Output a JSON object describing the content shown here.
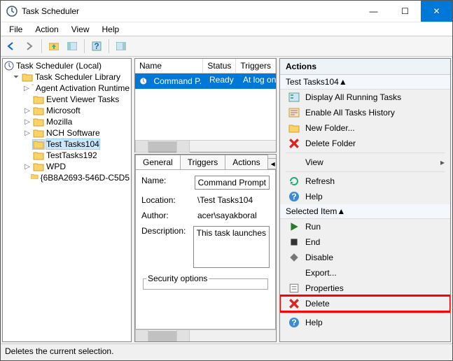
{
  "window": {
    "title": "Task Scheduler",
    "min": "—",
    "max": "☐",
    "close": "✕"
  },
  "menu": [
    "File",
    "Action",
    "View",
    "Help"
  ],
  "tree": {
    "root": "Task Scheduler (Local)",
    "lib": "Task Scheduler Library",
    "nodes": [
      "Agent Activation Runtime",
      "Event Viewer Tasks",
      "Microsoft",
      "Mozilla",
      "NCH Software",
      "Test Tasks104",
      "TestTasks192",
      "WPD",
      "{6B8A2693-546D-C5D5"
    ]
  },
  "tasklist": {
    "headers": {
      "name": "Name",
      "status": "Status",
      "triggers": "Triggers"
    },
    "row": {
      "name": "Command P...",
      "status": "Ready",
      "triggers": "At log on"
    }
  },
  "detail": {
    "tabs": [
      "General",
      "Triggers",
      "Actions"
    ],
    "name_label": "Name:",
    "name_value": "Command Prompt",
    "location_label": "Location:",
    "location_value": "\\Test Tasks104",
    "author_label": "Author:",
    "author_value": "acer\\sayakboral",
    "description_label": "Description:",
    "description_value": "This task launches",
    "security_label": "Security options"
  },
  "actions": {
    "header": "Actions",
    "section1": "",
    "items1": [
      {
        "label": "Display All Running Tasks"
      },
      {
        "label": "Enable All Tasks History"
      },
      {
        "label": "New Folder..."
      },
      {
        "label": "Delete Folder"
      },
      {
        "label": "View",
        "arrow": true
      },
      {
        "label": "Refresh"
      },
      {
        "label": "Help"
      }
    ],
    "section2": "Selected Item",
    "items2": [
      {
        "label": "Run"
      },
      {
        "label": "End"
      },
      {
        "label": "Disable"
      },
      {
        "label": "Export..."
      },
      {
        "label": "Properties"
      },
      {
        "label": "Delete",
        "highlight": true
      },
      {
        "label": "Help"
      }
    ]
  },
  "statusbar": "Deletes the current selection."
}
